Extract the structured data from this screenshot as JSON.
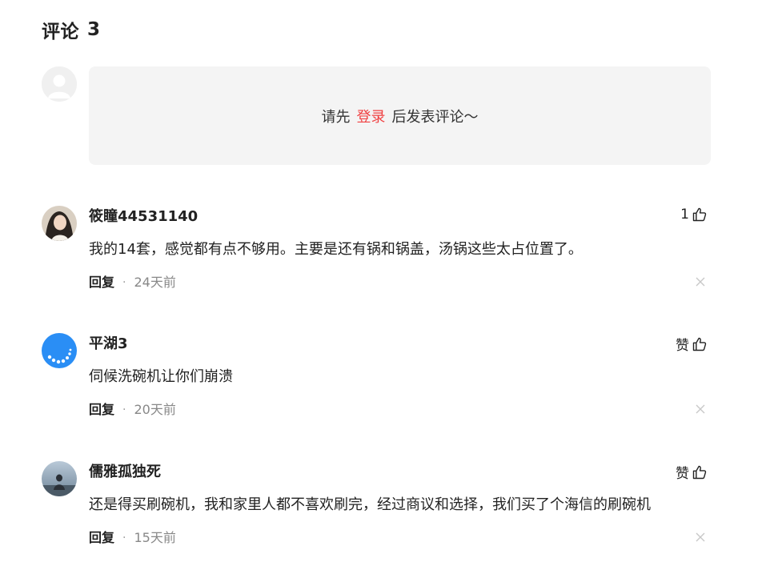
{
  "header": {
    "title": "评论",
    "count": "3"
  },
  "login_prompt": {
    "before": "请先",
    "link": "登录",
    "after": "后发表评论～"
  },
  "comments": [
    {
      "user": "筱瞳44531140",
      "like_count": "1",
      "like_label": "",
      "text": "我的14套，感觉都有点不够用。主要是还有锅和锅盖，汤锅这些太占位置了。",
      "reply_label": "回复",
      "time": "24天前"
    },
    {
      "user": "平湖3",
      "like_count": "",
      "like_label": "赞",
      "text": "伺候洗碗机让你们崩溃",
      "reply_label": "回复",
      "time": "20天前"
    },
    {
      "user": "儒雅孤独死",
      "like_count": "",
      "like_label": "赞",
      "text": "还是得买刷碗机，我和家里人都不喜欢刷完，经过商议和选择，我们买了个海信的刷碗机",
      "reply_label": "回复",
      "time": "15天前"
    }
  ],
  "icons": {
    "like": "thumbs-up-icon",
    "close": "close-icon",
    "avatar_placeholder": "user-silhouette-icon"
  },
  "colors": {
    "accent": "#f04142",
    "login_box_bg": "#f4f4f4",
    "avatar_blue": "#2a8ef5"
  }
}
